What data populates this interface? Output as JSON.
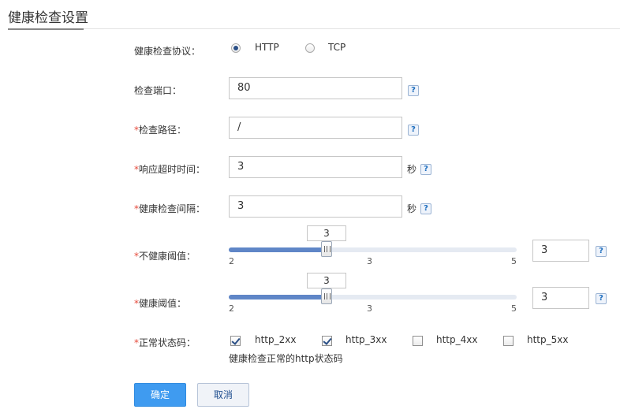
{
  "title": "健康检查设置",
  "protocol": {
    "label": "健康检查协议：",
    "options": [
      "HTTP",
      "TCP"
    ],
    "selected": "HTTP"
  },
  "port": {
    "label": "检查端口：",
    "value": "80"
  },
  "path": {
    "required_mark": "*",
    "label": "检查路径：",
    "value": "/"
  },
  "timeout": {
    "required_mark": "*",
    "label": "响应超时时间：",
    "value": "3",
    "unit": "秒"
  },
  "interval": {
    "required_mark": "*",
    "label": "健康检查间隔：",
    "value": "3",
    "unit": "秒"
  },
  "unhealthy_threshold": {
    "required_mark": "*",
    "label": "不健康阈值：",
    "value": "3",
    "min_label": "2",
    "mid_label": "3",
    "max_label": "5",
    "min": 2,
    "max": 5,
    "level": 3
  },
  "healthy_threshold": {
    "required_mark": "*",
    "label": "健康阈值：",
    "value": "3",
    "min_label": "2",
    "mid_label": "3",
    "max_label": "5",
    "min": 2,
    "max": 5,
    "level": 3
  },
  "status_codes": {
    "required_mark": "*",
    "label": "正常状态码：",
    "options": [
      {
        "label": "http_2xx",
        "checked": true
      },
      {
        "label": "http_3xx",
        "checked": true
      },
      {
        "label": "http_4xx",
        "checked": false
      },
      {
        "label": "http_5xx",
        "checked": false
      }
    ],
    "hint": "健康检查正常的http状态码"
  },
  "help_label": "?",
  "buttons": {
    "confirm": "确定",
    "cancel": "取消"
  },
  "colors": {
    "primary": "#3f9bf0",
    "required": "#e64b3c",
    "slider_fill": "#5f86c7"
  }
}
